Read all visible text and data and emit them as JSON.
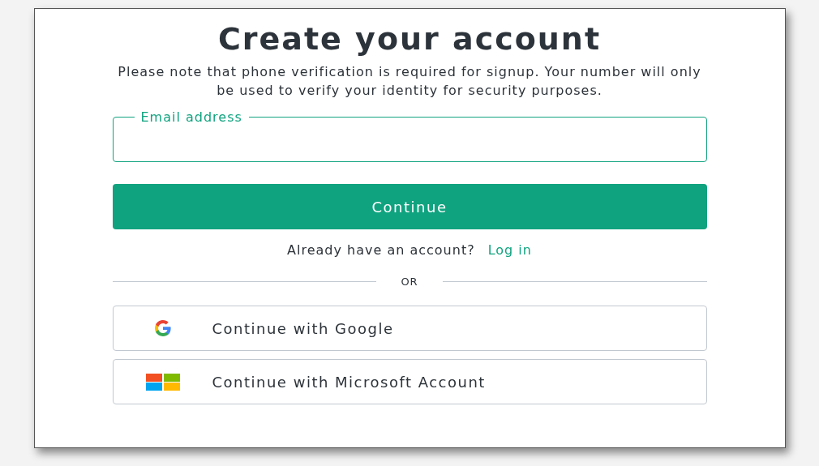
{
  "title": "Create your account",
  "notice": "Please note that phone verification is required for signup. Your number will only be used to verify your identity for security purposes.",
  "email_field": {
    "label": "Email address"
  },
  "continue_button": "Continue",
  "login_prompt": {
    "text": "Already have an account?",
    "link": "Log in"
  },
  "divider": "OR",
  "providers": [
    {
      "kind": "google",
      "label": "Continue with Google"
    },
    {
      "kind": "microsoft",
      "label": "Continue with Microsoft Account"
    }
  ]
}
